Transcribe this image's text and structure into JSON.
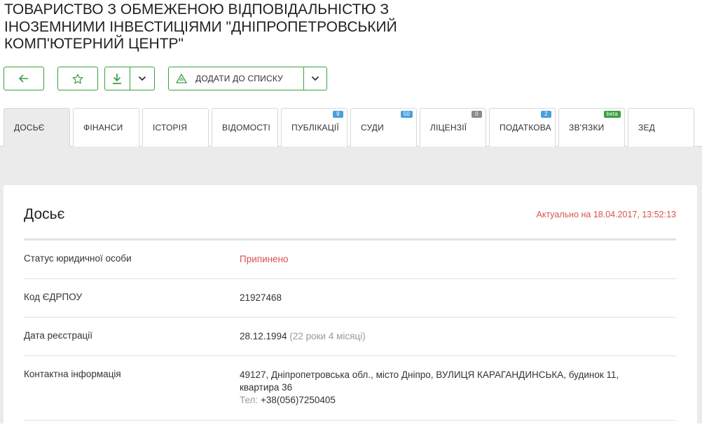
{
  "company": {
    "title_line1": "ТОВАРИСТВО З ОБМЕЖЕНОЮ ВІДПОВІДАЛЬНІСТЮ З",
    "title_line2": "ІНОЗЕМНИМИ ІНВЕСТИЦІЯМИ \"ДНІПРОПЕТРОВСЬКИЙ",
    "title_line3": "КОМП'ЮТЕРНИЙ ЦЕНТР\""
  },
  "toolbar": {
    "add_to_list_label": "ДОДАТИ ДО СПИСКУ"
  },
  "tabs": [
    {
      "label": "ДОСЬЄ",
      "badge": ""
    },
    {
      "label": "ФІНАНСИ",
      "badge": ""
    },
    {
      "label": "ІСТОРІЯ",
      "badge": ""
    },
    {
      "label": "ВІДОМОСТІ",
      "badge": ""
    },
    {
      "label": "ПУБЛІКАЦІЇ",
      "badge": "9"
    },
    {
      "label": "СУДИ",
      "badge": "50"
    },
    {
      "label": "ЛІЦЕНЗІЇ",
      "badge": "0"
    },
    {
      "label": "ПОДАТКОВА",
      "badge": "2"
    },
    {
      "label": "ЗВ'ЯЗКИ",
      "badge": "beta"
    },
    {
      "label": "ЗЕД",
      "badge": ""
    }
  ],
  "colors": {
    "accent": "#3aa13e",
    "badge_blue": "#4a9fdd",
    "badge_gray": "#8a8a8a",
    "badge_green": "#3aa13e",
    "status_red": "#d9534f"
  },
  "dossier": {
    "title": "Досьє",
    "updated": "Актуально на 18.04.2017, 13:52:13",
    "rows": [
      {
        "label": "Статус юридичної особи",
        "value": "Припинено"
      },
      {
        "label": "Код ЄДРПОУ",
        "value": "21927468"
      },
      {
        "label": "Дата реєстрації",
        "value": "28.12.1994",
        "note": "(22 роки 4 місяці)"
      },
      {
        "label": "Контактна інформація",
        "address_line1": "49127, Дніпропетровська обл., місто Дніпро, ВУЛИЦЯ КАРАГАНДИНСЬКА, будинок 11,",
        "address_line2": "квартира 36",
        "phone_label": "Тел:",
        "phone": "+38(056)7250405"
      }
    ]
  }
}
